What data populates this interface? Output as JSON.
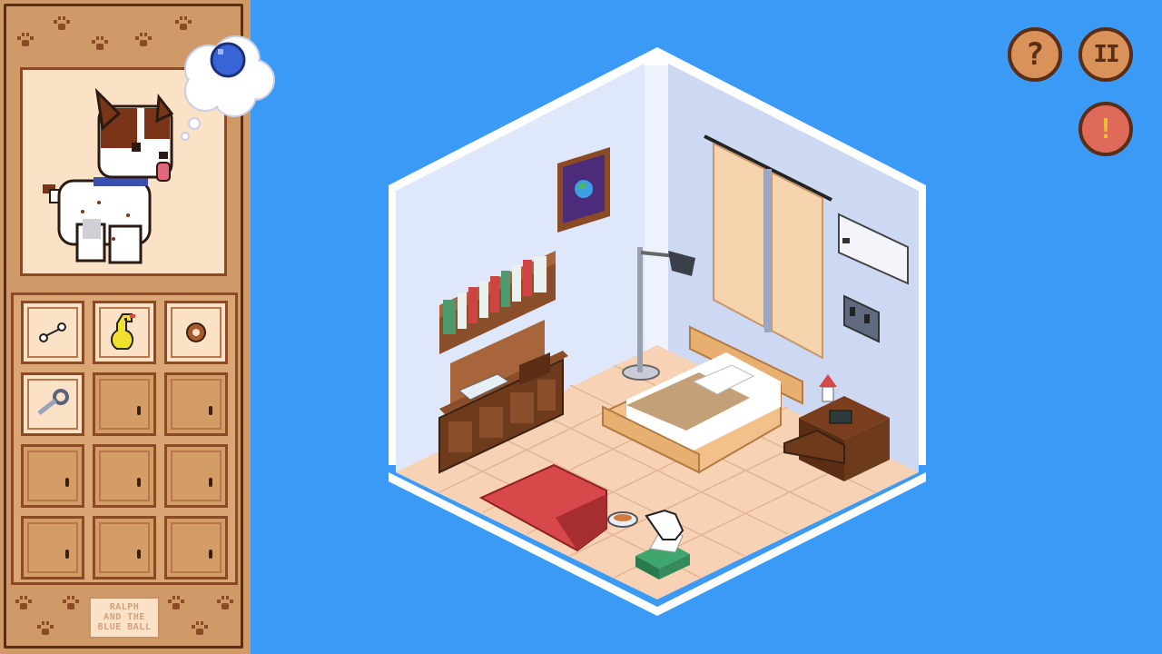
{
  "game": {
    "logo_lines": [
      "RALPH",
      "AND THE",
      "BLUE BALL"
    ]
  },
  "hud": {
    "help_label": "?",
    "pause_label": "II",
    "hint_label": "!"
  },
  "thought": {
    "item": "blue-ball"
  },
  "inventory": {
    "slots": [
      {
        "item": "bone",
        "selected": false
      },
      {
        "item": "rubber-chicken",
        "selected": true
      },
      {
        "item": "cookie",
        "selected": false
      },
      {
        "item": "key-ring",
        "selected": false
      },
      {
        "item": "",
        "selected": false
      },
      {
        "item": "",
        "selected": false
      },
      {
        "item": "",
        "selected": false
      },
      {
        "item": "",
        "selected": false
      },
      {
        "item": "",
        "selected": false
      },
      {
        "item": "",
        "selected": false
      },
      {
        "item": "",
        "selected": false
      },
      {
        "item": "",
        "selected": false
      }
    ]
  },
  "colors": {
    "background": "#3b9af6",
    "panel": "#cf9a68",
    "wall": "#dfe8fb",
    "floor": "#f7d2b4",
    "rug": "#d8474a",
    "hint_button": "#e06a5a"
  }
}
